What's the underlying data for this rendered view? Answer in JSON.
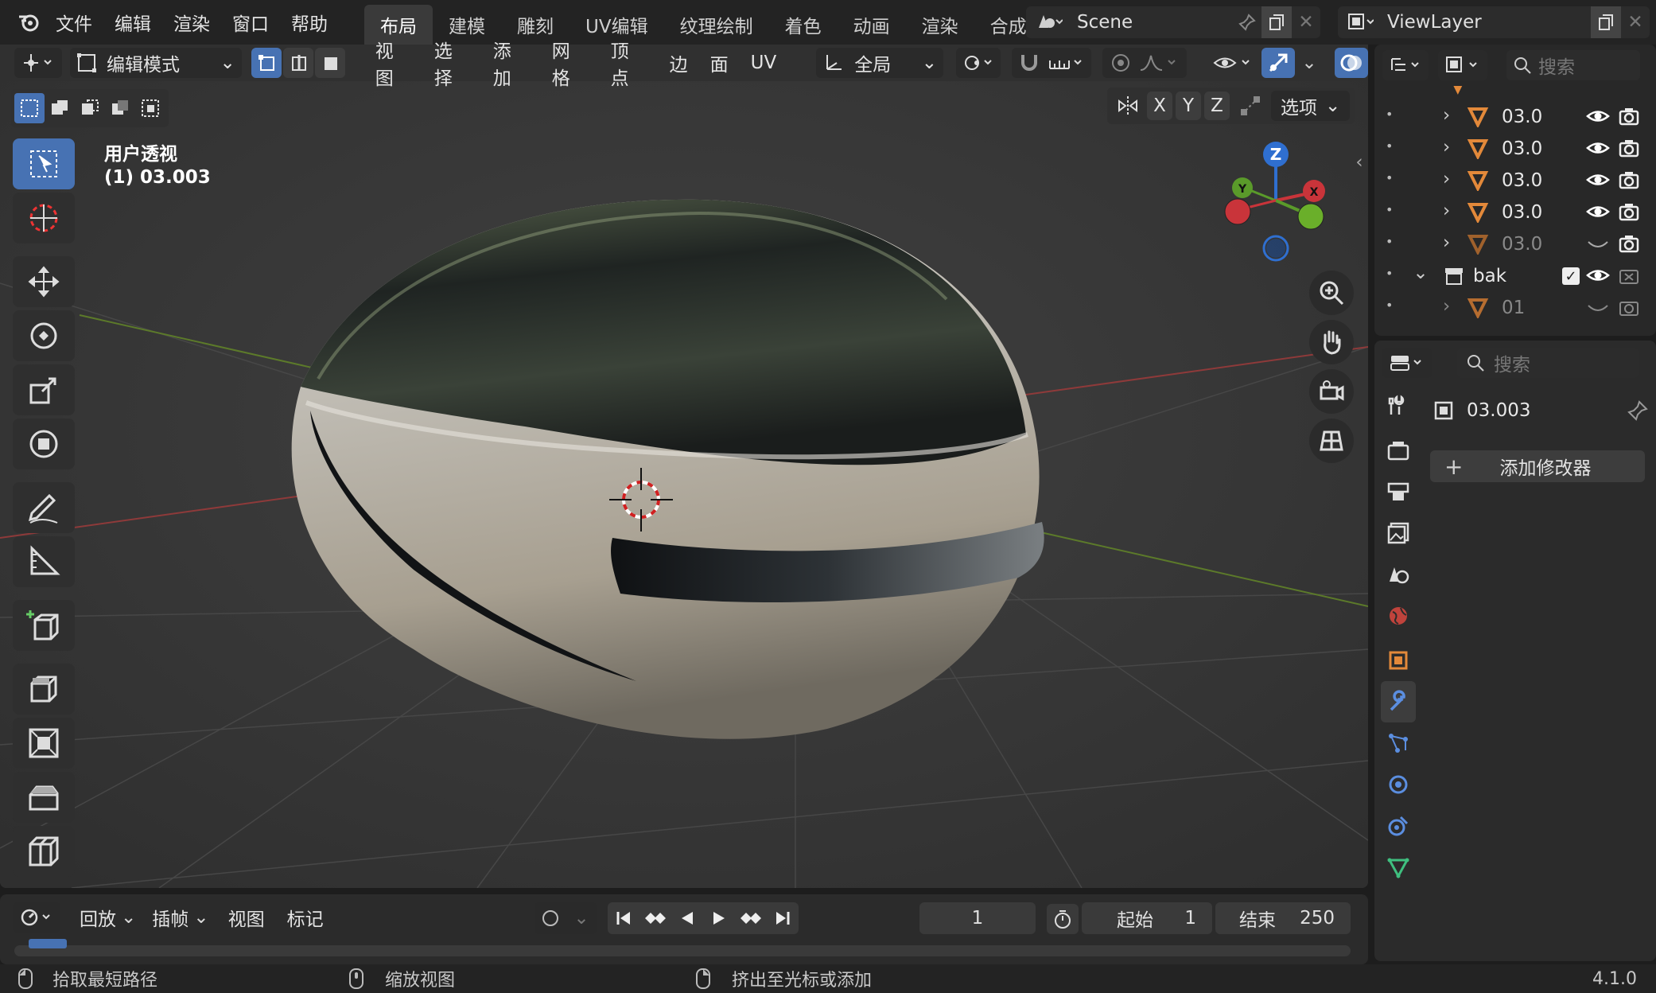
{
  "topbar": {
    "menus": [
      "文件",
      "编辑",
      "渲染",
      "窗口",
      "帮助"
    ],
    "workspaces": [
      "布局",
      "建模",
      "雕刻",
      "UV编辑",
      "纹理绘制",
      "着色",
      "动画",
      "渲染",
      "合成"
    ],
    "active_workspace": "布局",
    "scene_name": "Scene",
    "view_layer": "ViewLayer"
  },
  "viewport_header": {
    "mode": "编辑模式",
    "menus": [
      "视图",
      "选择",
      "添加",
      "网格",
      "顶点",
      "边",
      "面",
      "UV"
    ],
    "orientation": "全局",
    "axes": [
      "X",
      "Y",
      "Z"
    ],
    "options_label": "选项"
  },
  "viewport": {
    "view_name": "用户透视",
    "object_info": "(1) 03.003",
    "gizmo_labels": [
      "Z",
      "Y",
      "X"
    ]
  },
  "outliner": {
    "search_placeholder": "搜索",
    "rows": [
      {
        "label": "03.0",
        "visible": true
      },
      {
        "label": "03.0",
        "visible": true
      },
      {
        "label": "03.0",
        "visible": true
      },
      {
        "label": "03.0",
        "visible": true
      },
      {
        "label": "03.0",
        "visible": false
      }
    ],
    "collection": "bak",
    "child": "01"
  },
  "properties": {
    "search_placeholder": "搜索",
    "object_name": "03.003",
    "add_modifier": "添加修改器"
  },
  "timeline": {
    "menus": [
      "回放",
      "插帧",
      "视图",
      "标记"
    ],
    "current_frame": "1",
    "start_label": "起始",
    "start": "1",
    "end_label": "结束",
    "end": "250"
  },
  "statusbar": {
    "hint1": "拾取最短路径",
    "hint2": "缩放视图",
    "hint3": "挤出至光标或添加",
    "version": "4.1.0"
  },
  "colors": {
    "accent": "#4772b3",
    "panel": "#2b2b2b",
    "viewport_bg": "#3a3a3a",
    "orange": "#e3893a"
  }
}
